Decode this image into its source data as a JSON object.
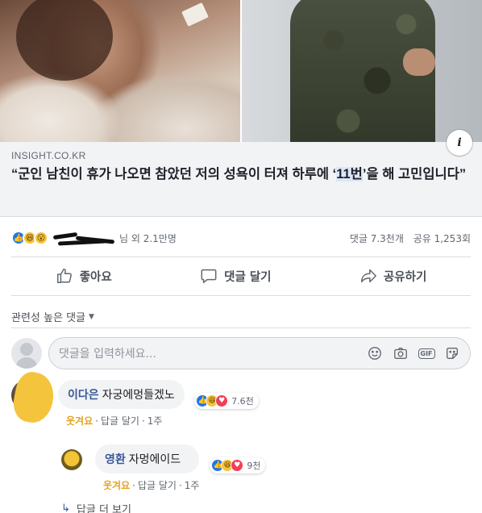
{
  "post": {
    "domain": "INSIGHT.CO.KR",
    "title_before": "“군인 남친이 휴가 나오면 참았던 저의 성욕이 터져 하루에 ‘",
    "title_highlight": "11번",
    "title_after": "’을 해 고민입니다”",
    "info_badge": "i"
  },
  "reactions": {
    "icons": [
      "like-icon",
      "haha-icon",
      "wow-icon"
    ],
    "names_suffix": "님 외 2.1만명",
    "comments_count": "댓글 7.3천개",
    "shares_count": "공유 1,253회"
  },
  "actions": {
    "like": "좋아요",
    "comment": "댓글 달기",
    "share": "공유하기"
  },
  "comments_section": {
    "sort_label": "관련성 높은 댓글",
    "input_placeholder": "댓글을 입력하세요...",
    "comments": [
      {
        "author": "이다은",
        "text": "자궁에멍들겠노",
        "reaction_count": "7.6천",
        "laugh_label": "웃겨요",
        "reply_label": "답글 달기",
        "time": "1주"
      },
      {
        "author": "영환",
        "text": "자멍에이드",
        "reaction_count": "9천",
        "laugh_label": "웃겨요",
        "reply_label": "답글 달기",
        "time": "1주"
      }
    ],
    "more_replies": "답글 더 보기"
  },
  "colors": {
    "link": "#385898",
    "like_blue": "#1877f2",
    "laugh_yellow": "#e4a320",
    "preview_bg": "#f2f3f5"
  }
}
